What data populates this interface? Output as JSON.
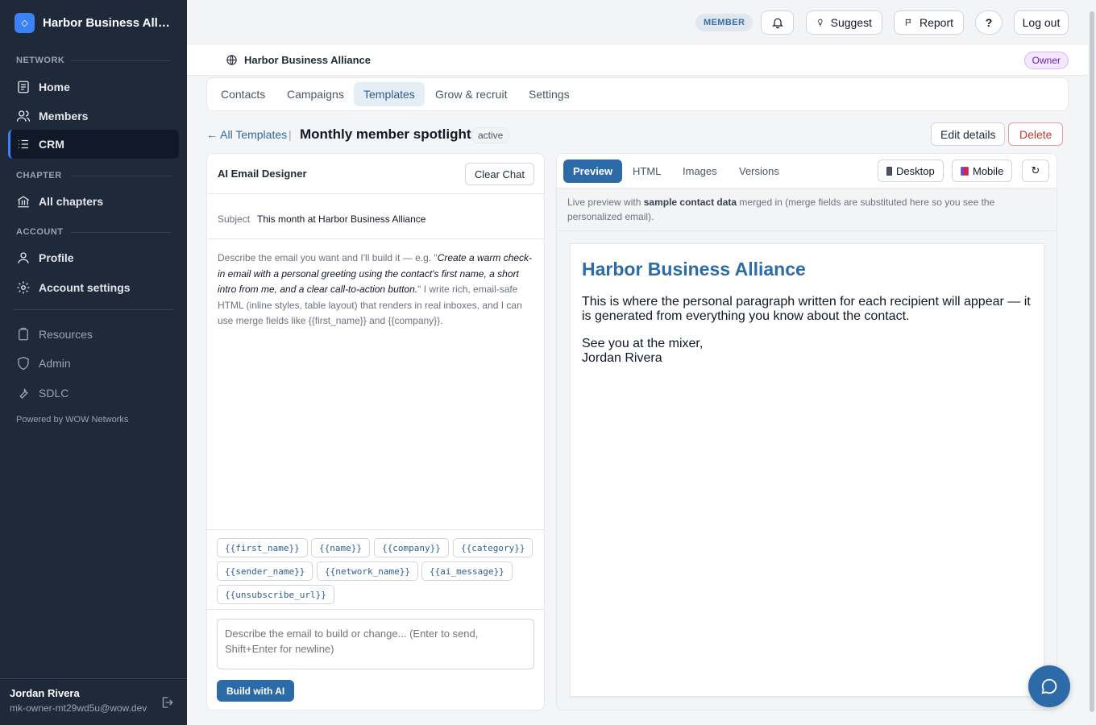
{
  "app": {
    "brand_name": "Harbor Business Allia...",
    "brand_logo": "◇"
  },
  "sidebar": {
    "sections": {
      "network": "NETWORK",
      "chapter": "CHAPTER",
      "account": "ACCOUNT"
    },
    "items": [
      {
        "label": "Home",
        "icon": "home-icon"
      },
      {
        "label": "Members",
        "icon": "users-icon"
      },
      {
        "label": "CRM",
        "icon": "list-icon",
        "active": true
      },
      {
        "label": "All chapters",
        "icon": "bank-icon"
      },
      {
        "label": "Profile",
        "icon": "user-icon"
      },
      {
        "label": "Account settings",
        "icon": "gear-icon"
      },
      {
        "label": "Resources",
        "icon": "clipboard-icon"
      },
      {
        "label": "Admin",
        "icon": "shield-icon"
      },
      {
        "label": "SDLC",
        "icon": "wrench-icon"
      }
    ],
    "powered_by": "Powered by WOW Networks",
    "user": {
      "name": "Jordan Rivera",
      "email": "mk-owner-mt29wd5u@wow.dev"
    }
  },
  "topbar": {
    "member_badge": "MEMBER",
    "suggest_label": "Suggest",
    "report_label": "Report",
    "help_label": "?",
    "logout_label": "Log out"
  },
  "header": {
    "network_name": "Harbor Business Alliance",
    "role_badge": "Owner"
  },
  "tabs": [
    {
      "label": "Contacts"
    },
    {
      "label": "Campaigns"
    },
    {
      "label": "Templates",
      "active": true
    },
    {
      "label": "Grow & recruit"
    },
    {
      "label": "Settings"
    }
  ],
  "template": {
    "back_label": "← All Templates",
    "separator": "|",
    "title": "Monthly member spotlight",
    "status": "active",
    "edit_label": "Edit details",
    "delete_label": "Delete"
  },
  "designer": {
    "title": "AI Email Designer",
    "clear_label": "Clear Chat",
    "subject_label": "Subject",
    "subject_value": "This month at Harbor Business Alliance",
    "hint_intro": "Describe the email you want and I'll build it — e.g. \"",
    "hint_example": "Create a warm check-in email with a personal greeting using the contact's first name, a short intro from me, and a clear call-to-action button.",
    "hint_outro": "\" I write rich, email-safe HTML (inline styles, table layout) that renders in real inboxes, and I can use merge fields like {{first_name}} and {{company}}.",
    "merge_fields": [
      "{{first_name}}",
      "{{name}}",
      "{{company}}",
      "{{category}}",
      "{{sender_name}}",
      "{{network_name}}",
      "{{ai_message}}",
      "{{unsubscribe_url}}"
    ],
    "prompt_placeholder": "Describe the email to build or change... (Enter to send, Shift+Enter for newline)",
    "build_label": "Build with AI"
  },
  "preview": {
    "tabs": [
      "Preview",
      "HTML",
      "Images",
      "Versions"
    ],
    "active_tab": "Preview",
    "desktop_label": "Desktop",
    "mobile_label": "Mobile",
    "refresh_label": "↻",
    "note_intro": "Live preview with ",
    "note_bold": "sample contact data",
    "note_rest": " merged in (merge fields are substituted here so you see the personalized email).",
    "email": {
      "heading": "Harbor Business Alliance",
      "body": "This is where the personal paragraph written for each recipient will appear — it is generated from everything you know about the contact.",
      "sign_line1": "See you at the mixer,",
      "sign_line2": "Jordan Rivera"
    }
  },
  "colors": {
    "accent": "#2d6aa8",
    "sidebar_bg": "#1e2939",
    "danger": "#c0392b"
  }
}
